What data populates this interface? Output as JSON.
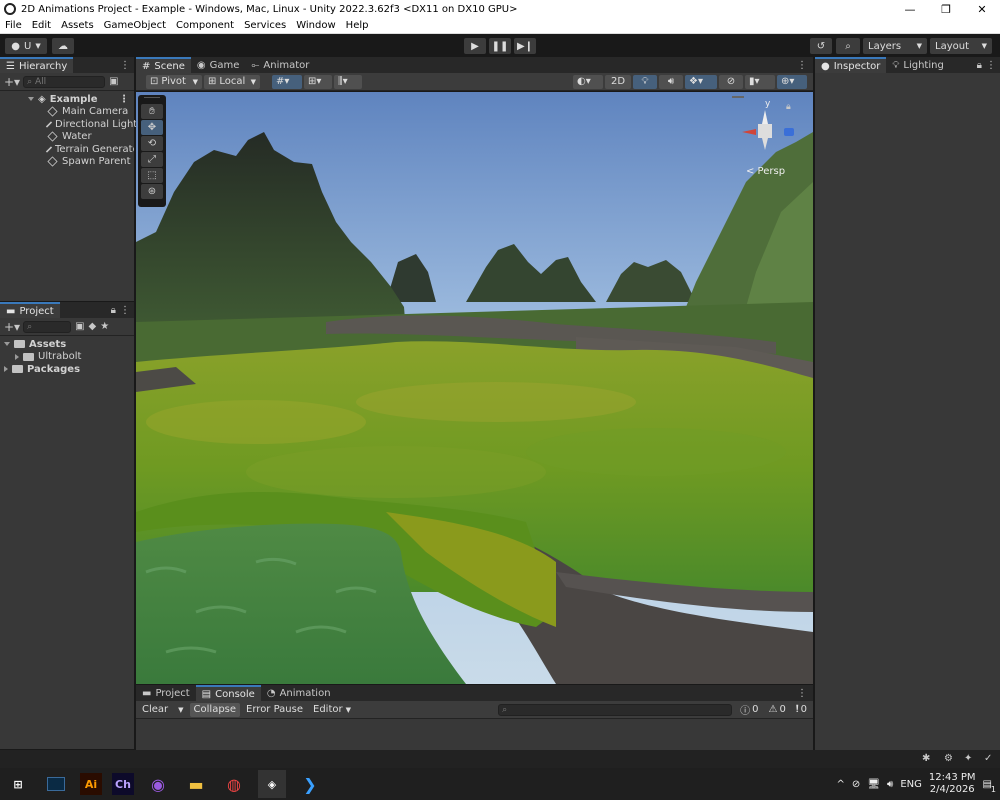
{
  "window": {
    "title": "2D Animations Project - Example - Windows, Mac, Linux - Unity 2022.3.62f3 <DX11 on DX10 GPU>",
    "minimize": "—",
    "restore": "❐",
    "close": "✕"
  },
  "menu": [
    "File",
    "Edit",
    "Assets",
    "GameObject",
    "Component",
    "Services",
    "Window",
    "Help"
  ],
  "toolbar": {
    "account": "U",
    "layers": "Layers",
    "layout": "Layout"
  },
  "hierarchy": {
    "tab": "Hierarchy",
    "search_placeholder": "All",
    "scene": "Example",
    "items": [
      "Main Camera",
      "Directional Light",
      "Water",
      "Terrain Generato",
      "Spawn Parent"
    ]
  },
  "project": {
    "tab": "Project",
    "assets": "Assets",
    "ultrabolt": "Ultrabolt",
    "packages": "Packages"
  },
  "scene_tabs": [
    {
      "label": "Scene",
      "icon": "grid-icon"
    },
    {
      "label": "Game",
      "icon": "gamepad-icon"
    },
    {
      "label": "Animator",
      "icon": "animator-icon"
    }
  ],
  "scene_toolbar": {
    "pivot": "Pivot",
    "local": "Local",
    "two_d": "2D",
    "persp": "< Persp"
  },
  "gizmo": {
    "y": "y",
    "x": "x"
  },
  "right_tabs": {
    "inspector": "Inspector",
    "lighting": "Lighting"
  },
  "bottom_tabs": {
    "project": "Project",
    "console": "Console",
    "animation": "Animation"
  },
  "console": {
    "clear": "Clear",
    "collapse": "Collapse",
    "error_pause": "Error Pause",
    "editor": "Editor",
    "count_info": "0",
    "count_warn": "0",
    "count_error": "0"
  },
  "taskbar": {
    "lang": "ENG",
    "time": "12:43 PM",
    "date": "2/4/2026",
    "notif": "1",
    "apps": [
      "Ai",
      "Ch"
    ]
  }
}
